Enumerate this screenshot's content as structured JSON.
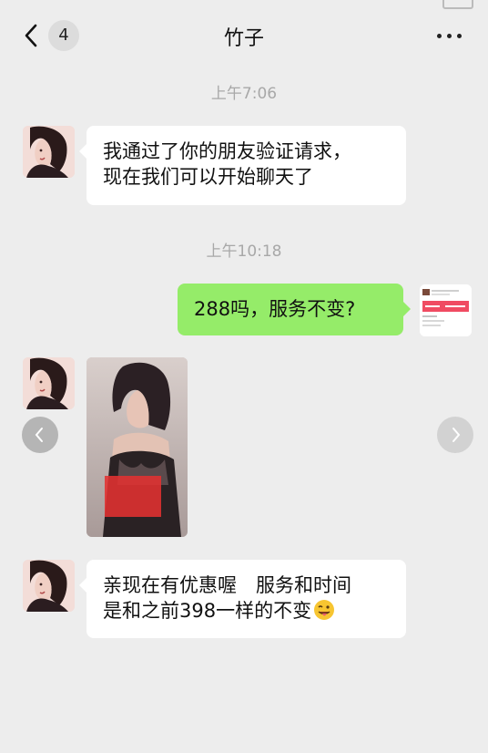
{
  "header": {
    "title": "竹子",
    "unread_count": "4",
    "back_icon": "chevron-left-icon",
    "more_icon": "ellipsis-icon"
  },
  "messages": [
    {
      "kind": "timestamp",
      "text": "上午7:06"
    },
    {
      "kind": "text",
      "direction": "incoming",
      "lines": [
        "我通过了你的朋友验证请求，",
        "现在我们可以开始聊天了"
      ]
    },
    {
      "kind": "timestamp",
      "text": "上午10:18"
    },
    {
      "kind": "text",
      "direction": "outgoing",
      "lines": [
        "288吗，服务不变?"
      ]
    },
    {
      "kind": "image",
      "direction": "incoming"
    },
    {
      "kind": "text",
      "direction": "incoming",
      "lines": [
        "亲现在有优惠喔　服务和时间",
        "是和之前398一样的不变"
      ],
      "trailing_emoji": "winking-tongue-face"
    }
  ],
  "colors": {
    "background": "#ededed",
    "outgoing_bubble": "#95ec69",
    "incoming_bubble": "#ffffff",
    "timestamp_text": "#a8a8a8"
  }
}
